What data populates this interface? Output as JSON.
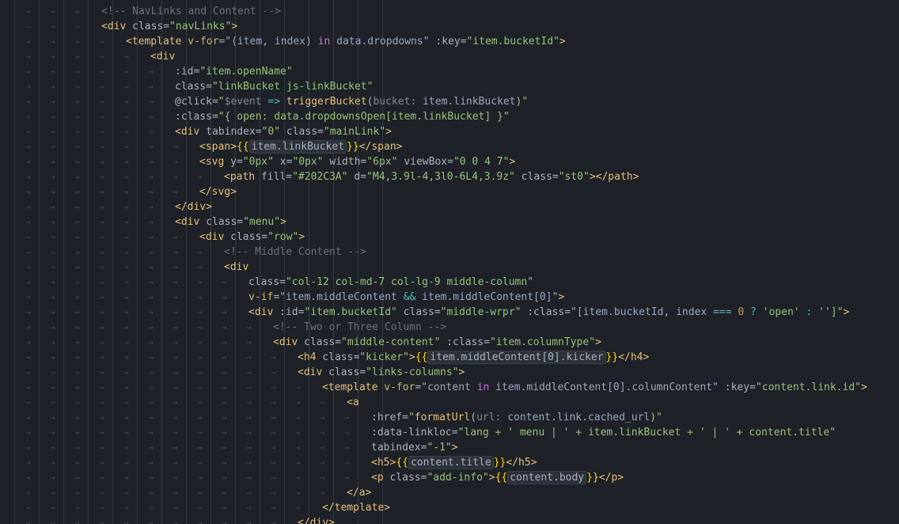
{
  "editor": {
    "background": "#1e2127",
    "lines": [
      {
        "indent": 4,
        "tokens": [
          {
            "t": "<!-- NavLinks and Content -->",
            "c": "com"
          }
        ]
      },
      {
        "indent": 4,
        "tokens": [
          {
            "t": "<div",
            "c": "tag"
          },
          {
            "t": " class",
            "c": "attr"
          },
          {
            "t": "=",
            "c": "punc"
          },
          {
            "t": "\"navLinks\"",
            "c": "str"
          },
          {
            "t": ">",
            "c": "tag"
          }
        ]
      },
      {
        "indent": 5,
        "tokens": [
          {
            "t": "<template",
            "c": "tag"
          },
          {
            "t": " v-for",
            "c": "dir"
          },
          {
            "t": "=",
            "c": "punc"
          },
          {
            "t": "\"(item, index) ",
            "c": "var"
          },
          {
            "t": "in",
            "c": "kw"
          },
          {
            "t": " data.dropdowns\"",
            "c": "var"
          },
          {
            "t": " :key",
            "c": "attr"
          },
          {
            "t": "=",
            "c": "punc"
          },
          {
            "t": "\"item.bucketId\"",
            "c": "str"
          },
          {
            "t": ">",
            "c": "tag"
          }
        ]
      },
      {
        "indent": 6,
        "tokens": [
          {
            "t": "<div",
            "c": "tag"
          }
        ]
      },
      {
        "indent": 7,
        "tokens": [
          {
            "t": ":id",
            "c": "attr"
          },
          {
            "t": "=",
            "c": "punc"
          },
          {
            "t": "\"item.openName\"",
            "c": "str"
          }
        ]
      },
      {
        "indent": 7,
        "tokens": [
          {
            "t": "class",
            "c": "attr"
          },
          {
            "t": "=",
            "c": "punc"
          },
          {
            "t": "\"linkBucket js-linkBucket\"",
            "c": "str"
          }
        ]
      },
      {
        "indent": 7,
        "tokens": [
          {
            "t": "@click",
            "c": "attr"
          },
          {
            "t": "=",
            "c": "punc"
          },
          {
            "t": "\"",
            "c": "str"
          },
          {
            "t": "$event",
            "c": "hint"
          },
          {
            "t": " => ",
            "c": "op"
          },
          {
            "t": "triggerBucket",
            "c": "fn"
          },
          {
            "t": "(",
            "c": "punc"
          },
          {
            "t": "bucket:",
            "c": "hint"
          },
          {
            "t": " item.linkBucket",
            "c": "var"
          },
          {
            "t": ")\"",
            "c": "str"
          }
        ]
      },
      {
        "indent": 7,
        "tokens": [
          {
            "t": ":class",
            "c": "attr"
          },
          {
            "t": "=",
            "c": "punc"
          },
          {
            "t": "\"{ open: data.dropdownsOpen[item.linkBucket] }\"",
            "c": "str"
          }
        ]
      },
      {
        "indent": 7,
        "tokens": [
          {
            "t": "<div",
            "c": "tag"
          },
          {
            "t": " tabindex",
            "c": "attr"
          },
          {
            "t": "=",
            "c": "punc"
          },
          {
            "t": "\"0\"",
            "c": "str"
          },
          {
            "t": " class",
            "c": "attr"
          },
          {
            "t": "=",
            "c": "punc"
          },
          {
            "t": "\"mainLink\"",
            "c": "str"
          },
          {
            "t": ">",
            "c": "tag"
          }
        ]
      },
      {
        "indent": 8,
        "tokens": [
          {
            "t": "<span>",
            "c": "tag"
          },
          {
            "t": "{{",
            "c": "brace"
          },
          {
            "t": "item.linkBucket",
            "c": "chip"
          },
          {
            "t": "}}",
            "c": "brace"
          },
          {
            "t": "</span>",
            "c": "tag"
          }
        ]
      },
      {
        "indent": 8,
        "tokens": [
          {
            "t": "<svg",
            "c": "tag"
          },
          {
            "t": " y",
            "c": "attr"
          },
          {
            "t": "=",
            "c": "punc"
          },
          {
            "t": "\"0px\"",
            "c": "str"
          },
          {
            "t": " x",
            "c": "attr"
          },
          {
            "t": "=",
            "c": "punc"
          },
          {
            "t": "\"0px\"",
            "c": "str"
          },
          {
            "t": " width",
            "c": "attr"
          },
          {
            "t": "=",
            "c": "punc"
          },
          {
            "t": "\"6px\"",
            "c": "str"
          },
          {
            "t": " viewBox",
            "c": "attr"
          },
          {
            "t": "=",
            "c": "punc"
          },
          {
            "t": "\"0 0 4 7\"",
            "c": "str"
          },
          {
            "t": ">",
            "c": "tag"
          }
        ]
      },
      {
        "indent": 9,
        "tokens": [
          {
            "t": "<path",
            "c": "tag"
          },
          {
            "t": " fill",
            "c": "attr"
          },
          {
            "t": "=",
            "c": "punc"
          },
          {
            "t": "\"#202C3A\"",
            "c": "str"
          },
          {
            "t": " d",
            "c": "attr"
          },
          {
            "t": "=",
            "c": "punc"
          },
          {
            "t": "\"M4,3.9l-4,3l0-6L4,3.9z\"",
            "c": "str"
          },
          {
            "t": " class",
            "c": "attr"
          },
          {
            "t": "=",
            "c": "punc"
          },
          {
            "t": "\"st0\"",
            "c": "str"
          },
          {
            "t": "></path>",
            "c": "tag"
          }
        ]
      },
      {
        "indent": 8,
        "tokens": [
          {
            "t": "</svg>",
            "c": "tag"
          }
        ]
      },
      {
        "indent": 7,
        "tokens": [
          {
            "t": "</div>",
            "c": "tag"
          }
        ]
      },
      {
        "indent": 7,
        "tokens": [
          {
            "t": "<div",
            "c": "tag"
          },
          {
            "t": " class",
            "c": "attr"
          },
          {
            "t": "=",
            "c": "punc"
          },
          {
            "t": "\"menu\"",
            "c": "str"
          },
          {
            "t": ">",
            "c": "tag"
          }
        ]
      },
      {
        "indent": 8,
        "tokens": [
          {
            "t": "<div",
            "c": "tag"
          },
          {
            "t": " class",
            "c": "attr"
          },
          {
            "t": "=",
            "c": "punc"
          },
          {
            "t": "\"row\"",
            "c": "str"
          },
          {
            "t": ">",
            "c": "tag"
          }
        ]
      },
      {
        "indent": 9,
        "tokens": [
          {
            "t": "<!-- Middle Content -->",
            "c": "com"
          }
        ]
      },
      {
        "indent": 9,
        "tokens": [
          {
            "t": "<div",
            "c": "tag"
          }
        ]
      },
      {
        "indent": 10,
        "tokens": [
          {
            "t": "class",
            "c": "attr"
          },
          {
            "t": "=",
            "c": "punc"
          },
          {
            "t": "\"col-12 col-md-7 col-lg-9 middle-column\"",
            "c": "str"
          }
        ]
      },
      {
        "indent": 10,
        "tokens": [
          {
            "t": "v-if",
            "c": "dir"
          },
          {
            "t": "=",
            "c": "punc"
          },
          {
            "t": "\"item.middleContent ",
            "c": "var"
          },
          {
            "t": "&&",
            "c": "op"
          },
          {
            "t": " item.middleContent[0]\"",
            "c": "var"
          },
          {
            "t": ">",
            "c": "tag"
          }
        ]
      },
      {
        "indent": 10,
        "tokens": [
          {
            "t": "<div",
            "c": "tag"
          },
          {
            "t": " :id",
            "c": "attr"
          },
          {
            "t": "=",
            "c": "punc"
          },
          {
            "t": "\"item.bucketId\"",
            "c": "str"
          },
          {
            "t": " class",
            "c": "attr"
          },
          {
            "t": "=",
            "c": "punc"
          },
          {
            "t": "\"middle-wrpr\"",
            "c": "str"
          },
          {
            "t": " :class",
            "c": "attr"
          },
          {
            "t": "=",
            "c": "punc"
          },
          {
            "t": "\"[item.bucketId, index ",
            "c": "var"
          },
          {
            "t": "===",
            "c": "op"
          },
          {
            "t": " 0 ",
            "c": "num"
          },
          {
            "t": "?",
            "c": "op"
          },
          {
            "t": " 'open'",
            "c": "str"
          },
          {
            "t": " : ",
            "c": "op"
          },
          {
            "t": "'']\"",
            "c": "str"
          },
          {
            "t": ">",
            "c": "tag"
          }
        ]
      },
      {
        "indent": 11,
        "tokens": [
          {
            "t": "<!-- Two or Three Column -->",
            "c": "com"
          }
        ]
      },
      {
        "indent": 11,
        "tokens": [
          {
            "t": "<div",
            "c": "tag"
          },
          {
            "t": " class",
            "c": "attr"
          },
          {
            "t": "=",
            "c": "punc"
          },
          {
            "t": "\"middle-content\"",
            "c": "str"
          },
          {
            "t": " :class",
            "c": "attr"
          },
          {
            "t": "=",
            "c": "punc"
          },
          {
            "t": "\"item.columnType\"",
            "c": "str"
          },
          {
            "t": ">",
            "c": "tag"
          }
        ]
      },
      {
        "indent": 12,
        "tokens": [
          {
            "t": "<h4",
            "c": "tag"
          },
          {
            "t": " class",
            "c": "attr"
          },
          {
            "t": "=",
            "c": "punc"
          },
          {
            "t": "\"kicker\"",
            "c": "str"
          },
          {
            "t": ">",
            "c": "tag"
          },
          {
            "t": "{{",
            "c": "brace"
          },
          {
            "t": "item.middleContent[0].kicker",
            "c": "chip"
          },
          {
            "t": "}}",
            "c": "brace"
          },
          {
            "t": "</h4>",
            "c": "tag"
          }
        ]
      },
      {
        "indent": 12,
        "tokens": [
          {
            "t": "<div",
            "c": "tag"
          },
          {
            "t": " class",
            "c": "attr"
          },
          {
            "t": "=",
            "c": "punc"
          },
          {
            "t": "\"links-columns\"",
            "c": "str"
          },
          {
            "t": ">",
            "c": "tag"
          }
        ]
      },
      {
        "indent": 13,
        "tokens": [
          {
            "t": "<template",
            "c": "tag"
          },
          {
            "t": " v-for",
            "c": "dir"
          },
          {
            "t": "=",
            "c": "punc"
          },
          {
            "t": "\"content ",
            "c": "var"
          },
          {
            "t": "in",
            "c": "kw"
          },
          {
            "t": " item.middleContent[0].columnContent\"",
            "c": "var"
          },
          {
            "t": " :key",
            "c": "attr"
          },
          {
            "t": "=",
            "c": "punc"
          },
          {
            "t": "\"content.link.id\"",
            "c": "str"
          },
          {
            "t": ">",
            "c": "tag"
          }
        ]
      },
      {
        "indent": 14,
        "tokens": [
          {
            "t": "<a",
            "c": "tag"
          }
        ]
      },
      {
        "indent": 15,
        "tokens": [
          {
            "t": ":href",
            "c": "attr"
          },
          {
            "t": "=",
            "c": "punc"
          },
          {
            "t": "\"",
            "c": "str"
          },
          {
            "t": "formatUrl",
            "c": "fn"
          },
          {
            "t": "(",
            "c": "punc"
          },
          {
            "t": "url:",
            "c": "hint"
          },
          {
            "t": " content.link.cached_url",
            "c": "var"
          },
          {
            "t": ")\"",
            "c": "str"
          }
        ]
      },
      {
        "indent": 15,
        "tokens": [
          {
            "t": ":data-linkloc",
            "c": "attr"
          },
          {
            "t": "=",
            "c": "punc"
          },
          {
            "t": "\"lang + ' menu | ' + item.linkBucket + ' | ' + content.title\"",
            "c": "str"
          }
        ]
      },
      {
        "indent": 15,
        "tokens": [
          {
            "t": "tabindex",
            "c": "attr"
          },
          {
            "t": "=",
            "c": "punc"
          },
          {
            "t": "\"-1\"",
            "c": "str"
          },
          {
            "t": ">",
            "c": "tag"
          }
        ]
      },
      {
        "indent": 15,
        "tokens": [
          {
            "t": "<h5>",
            "c": "tag"
          },
          {
            "t": "{{",
            "c": "brace"
          },
          {
            "t": "content.title",
            "c": "chip"
          },
          {
            "t": "}}",
            "c": "brace"
          },
          {
            "t": "</h5>",
            "c": "tag"
          }
        ]
      },
      {
        "indent": 15,
        "tokens": [
          {
            "t": "<p",
            "c": "tag"
          },
          {
            "t": " class",
            "c": "attr"
          },
          {
            "t": "=",
            "c": "punc"
          },
          {
            "t": "\"add-info\"",
            "c": "str"
          },
          {
            "t": ">",
            "c": "tag"
          },
          {
            "t": "{{",
            "c": "brace"
          },
          {
            "t": "content.body",
            "c": "chip"
          },
          {
            "t": "}}",
            "c": "brace"
          },
          {
            "t": "</p>",
            "c": "tag"
          }
        ]
      },
      {
        "indent": 14,
        "tokens": [
          {
            "t": "</a>",
            "c": "tag"
          }
        ]
      },
      {
        "indent": 13,
        "tokens": [
          {
            "t": "</template>",
            "c": "tag"
          }
        ]
      },
      {
        "indent": 12,
        "tokens": [
          {
            "t": "</div>",
            "c": "tag"
          }
        ]
      }
    ]
  }
}
